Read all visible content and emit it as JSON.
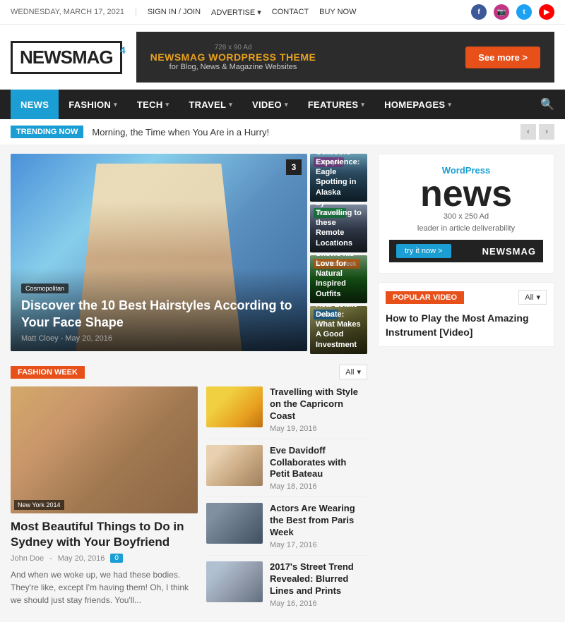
{
  "topbar": {
    "date": "WEDNESDAY, MARCH 17, 2021",
    "signin": "SIGN IN / JOIN",
    "advertise": "ADVERTISE",
    "contact": "CONTACT",
    "buynow": "BUY NOW"
  },
  "header": {
    "logo_text": "NEWSMAG",
    "logo_num": "4",
    "ad_label": "728 x 90 Ad",
    "ad_title": "NEWSMAG WORDPRESS THEME",
    "ad_sub": "for Blog, News & Magazine Websites",
    "see_more": "See more >"
  },
  "nav": {
    "items": [
      {
        "label": "NEWS",
        "active": true,
        "dropdown": false
      },
      {
        "label": "FASHION",
        "active": false,
        "dropdown": true
      },
      {
        "label": "TECH",
        "active": false,
        "dropdown": true
      },
      {
        "label": "TRAVEL",
        "active": false,
        "dropdown": true
      },
      {
        "label": "VIDEO",
        "active": false,
        "dropdown": true
      },
      {
        "label": "FEATURES",
        "active": false,
        "dropdown": true
      },
      {
        "label": "HOMEPAGES",
        "active": false,
        "dropdown": true
      }
    ]
  },
  "trending": {
    "label": "TRENDING NOW",
    "text": "Morning, the Time when You Are in a Hurry!"
  },
  "hero": {
    "category": "Cosmopolitan",
    "title": "Discover the 10 Best Hairstyles According to Your Face Shape",
    "author": "Matt Cloey",
    "date": "May 20, 2016",
    "badge": "3",
    "side_items": [
      {
        "category": "Lifestyle",
        "title": "Wonderful Outdoors Experience: Eagle Spotting in Alaska"
      },
      {
        "category": "Activities",
        "title": "Improve your Health by Travelling to these Remote Locations"
      },
      {
        "category": "Fashion week",
        "title": "Kevin Smith Shows his Love for Natural Inspired Outfits"
      },
      {
        "category": "Travel",
        "title": "The Big Real Estate Debate: What Makes A Good Investment"
      }
    ]
  },
  "fashion_section": {
    "badge": "FASHION WEEK",
    "filter": "All",
    "main": {
      "year_badge": "New York 2014",
      "title": "Most Beautiful Things to Do in Sydney with Your Boyfriend",
      "author": "John Doe",
      "date": "May 20, 2016",
      "comments": "0",
      "excerpt": "And when we woke up, we had these bodies. They're like, except I'm having them! Oh, I think we should just stay friends. You'll..."
    },
    "list_items": [
      {
        "title": "Travelling with Style on the Capricorn Coast",
        "date": "May 19, 2016"
      },
      {
        "title": "Eve Davidoff Collaborates with Petit Bateau",
        "date": "May 18, 2016"
      },
      {
        "title": "Actors Are Wearing the Best from Paris Week",
        "date": "May 17, 2016"
      },
      {
        "title": "2017's Street Trend Revealed: Blurred Lines and Prints",
        "date": "May 16, 2016"
      }
    ]
  },
  "wp_ad": {
    "top": "WordPress",
    "news": "news",
    "size": "300 x 250 Ad",
    "desc": "leader in article deliverability",
    "try_btn": "try it now >",
    "brand": "NEWSMAG"
  },
  "popular": {
    "badge": "POPULAR VIDEO",
    "filter": "All",
    "video_title": "How to Play the Most Amazing Instrument [Video]"
  }
}
